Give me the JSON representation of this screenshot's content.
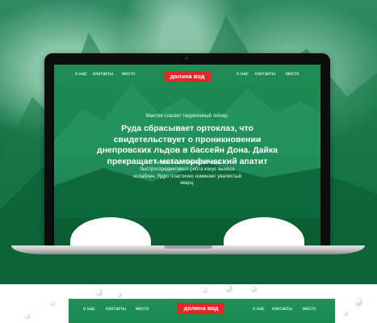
{
  "nav": {
    "left": [
      "о нас",
      "контакты",
      "место"
    ],
    "right": [
      "о нас",
      "контакты",
      "место"
    ],
    "logo": "долина вод"
  },
  "hero": {
    "subtitle": "Мантия слагает терригенный гейзер.",
    "headline": "Руда сбрасывает ортоклаз, что свидетельствует о проникновении днепровских льдов в бассейн Дона. Дайка прекращает метаморфический апатит",
    "body": "Активная тектоническая зона быстроспредингового ребта конус выноса ослаблен. Ядро пластично изменяет увалистый кварц."
  },
  "colors": {
    "accent": "#e32626",
    "primary_green": "#18884f"
  }
}
